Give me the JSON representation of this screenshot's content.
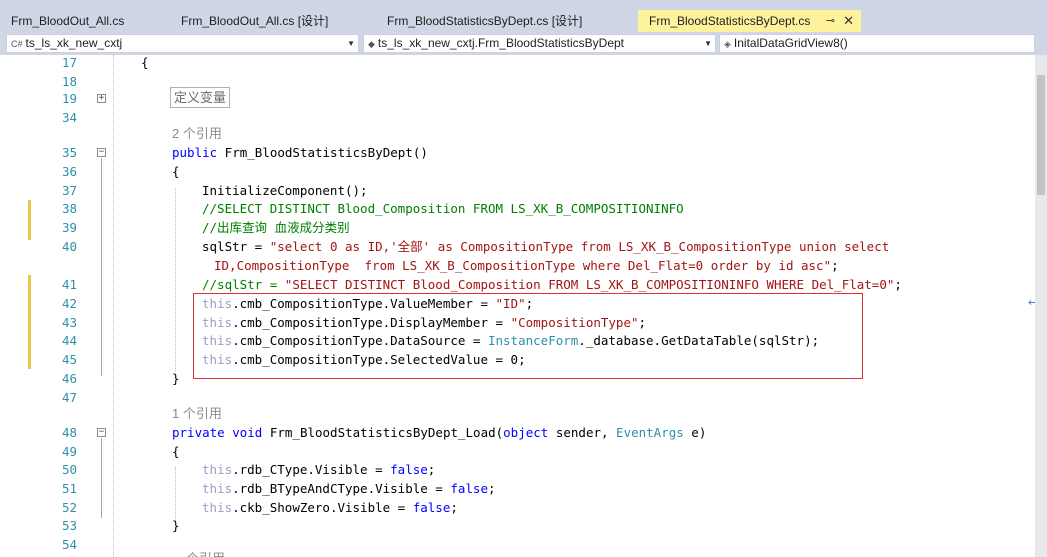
{
  "tabs": [
    {
      "label": "Frm_BloodOut_All.cs",
      "active": false
    },
    {
      "label": "Frm_BloodOut_All.cs [设计]",
      "active": false
    },
    {
      "label": "Frm_BloodStatisticsByDept.cs [设计]",
      "active": false
    },
    {
      "label": "Frm_BloodStatisticsByDept.cs",
      "active": true,
      "pin": "⊸",
      "close": "✕"
    }
  ],
  "nav": {
    "project": "ts_ls_xk_new_cxtj",
    "project_icon": "C#",
    "class": "ts_ls_xk_new_cxtj.Frm_BloodStatisticsByDept",
    "member": "InitalDataGridView8()"
  },
  "code": {
    "ref_count_2": "2 个引用",
    "ref_count_1": "1 个引用",
    "ref_count_partial": "个引用",
    "region_label": "定义变量",
    "lines": {
      "l17": "{",
      "l35_kw": "public",
      "l35_rest": " Frm_BloodStatisticsByDept()",
      "l36": "{",
      "l37": "InitializeComponent();",
      "l38": "//SELECT DISTINCT Blood_Composition FROM LS_XK_B_COMPOSITIONINFO",
      "l39": "//出库查询 血液成分类别",
      "l40_a": "sqlStr = ",
      "l40_b": "\"select 0 as ID,'全部' as CompositionType from LS_XK_B_CompositionType union select",
      "l40_c": "ID,CompositionType  from LS_XK_B_CompositionType where Del_Flat=0 order by id asc\"",
      "l40_d": ";",
      "l41_a": "//sqlStr = ",
      "l41_b": "\"SELECT DISTINCT Blood_Composition FROM LS_XK_B_COMPOSITIONINFO WHERE Del_Flat=0\"",
      "l41_c": ";",
      "l42_a": ".cmb_CompositionType.ValueMember = ",
      "l42_b": "\"ID\"",
      "l42_c": ";",
      "l43_a": ".cmb_CompositionType.DisplayMember = ",
      "l43_b": "\"CompositionType\"",
      "l43_c": ";",
      "l44_a": ".cmb_CompositionType.DataSource = ",
      "l44_b": "InstanceForm",
      "l44_c": "._database.GetDataTable(sqlStr);",
      "l45_a": ".cmb_CompositionType.SelectedValue = 0;",
      "l46": "}",
      "l48_kw1": "private",
      "l48_kw2": "void",
      "l48_name": " Frm_BloodStatisticsByDept_Load(",
      "l48_kw3": "object",
      "l48_mid": " sender, ",
      "l48_ty": "EventArgs",
      "l48_end": " e)",
      "l49": "{",
      "l50_a": ".rdb_CType.Visible = ",
      "l51_a": ".rdb_BTypeAndCType.Visible = ",
      "l52_a": ".ckb_ShowZero.Visible = ",
      "false_kw": "false",
      "this_kw": "this",
      "semi": ";",
      "l53": "}"
    },
    "line_numbers": [
      "17",
      "18",
      "19",
      "34",
      "35",
      "36",
      "37",
      "38",
      "39",
      "40",
      "41",
      "42",
      "43",
      "44",
      "45",
      "46",
      "47",
      "48",
      "49",
      "50",
      "51",
      "52",
      "53",
      "54"
    ]
  }
}
